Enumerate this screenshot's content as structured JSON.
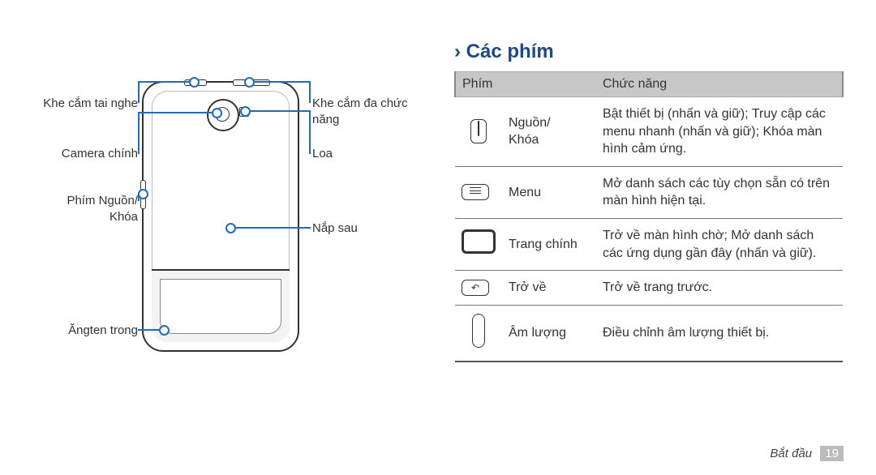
{
  "heading_prefix": "›",
  "heading": "Các phím",
  "phone_labels": {
    "headset_jack": "Khe cắm tai nghe",
    "main_camera": "Camera chính",
    "power_lock_key": "Phím Nguồn/\nKhóa",
    "internal_antenna": "Ăngten trong",
    "multi_jack": "Khe cắm đa chức\nnăng",
    "speaker": "Loa",
    "back_cover": "Nắp sau"
  },
  "table": {
    "col1": "Phím",
    "col2": "Chức năng",
    "rows": [
      {
        "icon": "power",
        "name": "Nguồn/\nKhóa",
        "desc": "Bật thiết bị (nhấn và giữ); Truy cập các menu nhanh (nhấn và giữ); Khóa màn hình cảm ứng."
      },
      {
        "icon": "menu",
        "name": "Menu",
        "desc": "Mở danh sách các tùy chọn sẵn có trên màn hình hiện tại."
      },
      {
        "icon": "home",
        "name": "Trang chính",
        "desc": "Trở về màn hình chờ; Mở danh sách các ứng dụng gần đây (nhấn và giữ)."
      },
      {
        "icon": "back",
        "name": "Trở về",
        "desc": "Trở về trang trước."
      },
      {
        "icon": "volume",
        "name": "Âm lượng",
        "desc": "Điều chỉnh âm lượng thiết bị."
      }
    ]
  },
  "footer": {
    "section": "Bắt đầu",
    "page": "19"
  }
}
